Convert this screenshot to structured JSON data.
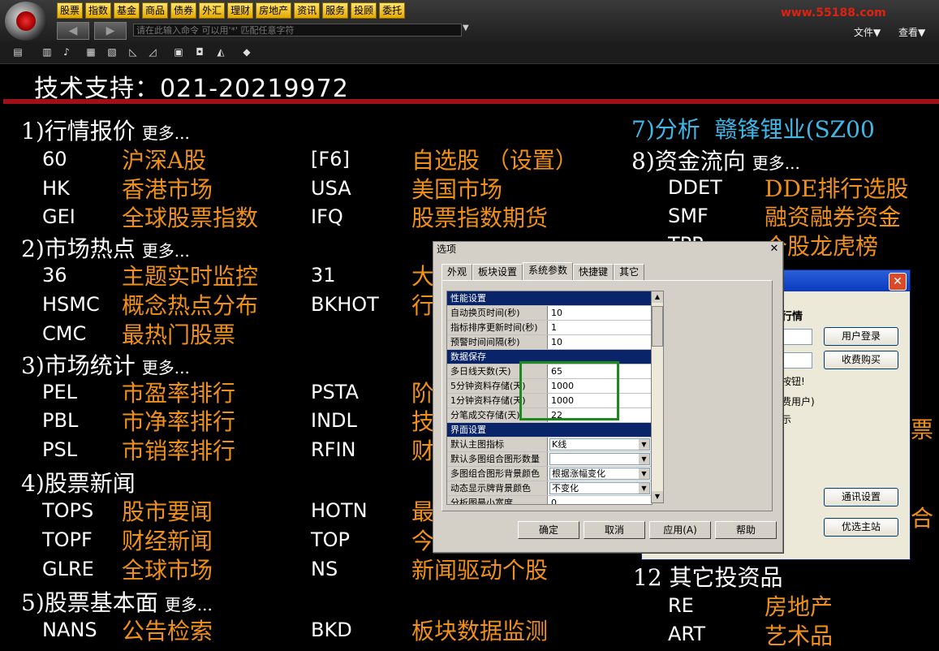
{
  "menu": [
    "股票",
    "指数",
    "基金",
    "商品",
    "债券",
    "外汇",
    "理财",
    "房地产",
    "资讯",
    "服务",
    "投顾",
    "委托"
  ],
  "command_placeholder": "请在此输入命令     可以用'*' 匹配任意字符",
  "right_menu": {
    "file": "文件▼",
    "view": "查看▼"
  },
  "site_text": "www.55188.com",
  "support": "技术支持：021-20219972",
  "sections": {
    "s1": {
      "title": "1)行情报价",
      "more": "更多..."
    },
    "s2": {
      "title": "2)市场热点",
      "more": "更多..."
    },
    "s3": {
      "title": "3)市场统计",
      "more": "更多..."
    },
    "s4": {
      "title": "4)股票新闻"
    },
    "s5": {
      "title": "5)股票基本面",
      "more": "更多..."
    },
    "s7": {
      "title": "7)分析",
      "stock": "赣锋锂业(SZ00"
    },
    "s8": {
      "title": "8)资金流向",
      "more": "更多..."
    },
    "s12": {
      "title": "12 其它投资品"
    }
  },
  "rows": {
    "r60": {
      "code": "60",
      "label": "沪深A股"
    },
    "rF6": {
      "code": "[F6]",
      "label": "自选股  （设置）"
    },
    "rHK": {
      "code": "HK",
      "label": "香港市场"
    },
    "rUSA": {
      "code": "USA",
      "label": "美国市场"
    },
    "rGEI": {
      "code": "GEI",
      "label": "全球股票指数"
    },
    "rIFQ": {
      "code": "IFQ",
      "label": "股票指数期货"
    },
    "r36": {
      "code": "36",
      "label": "主题实时监控"
    },
    "r31": {
      "code": "31",
      "label": "大"
    },
    "rHSMC": {
      "code": "HSMC",
      "label": "概念热点分布"
    },
    "rBKHOT": {
      "code": "BKHOT",
      "label": "行"
    },
    "rCMC": {
      "code": "CMC",
      "label": "最热门股票"
    },
    "rPEL": {
      "code": "PEL",
      "label": "市盈率排行"
    },
    "rPSTA": {
      "code": "PSTA",
      "label": "阶"
    },
    "rPBL": {
      "code": "PBL",
      "label": "市净率排行"
    },
    "rINDL": {
      "code": "INDL",
      "label": "技"
    },
    "rPSL": {
      "code": "PSL",
      "label": "市销率排行"
    },
    "rRFIN": {
      "code": "RFIN",
      "label": "财"
    },
    "rTOPS": {
      "code": "TOPS",
      "label": "股市要闻"
    },
    "rHOTN": {
      "code": "HOTN",
      "label": "最"
    },
    "rTOPF": {
      "code": "TOPF",
      "label": "财经新闻"
    },
    "rTOP": {
      "code": "TOP",
      "label": "今"
    },
    "rGLRE": {
      "code": "GLRE",
      "label": "全球市场"
    },
    "rNS": {
      "code": "NS",
      "label": "新闻驱动个股"
    },
    "rNANS": {
      "code": "NANS",
      "label": "公告检索"
    },
    "rBKD": {
      "code": "BKD",
      "label": "板块数据监测"
    },
    "rDDET": {
      "code": "DDET",
      "label": "DDE排行选股"
    },
    "rSMF": {
      "code": "SMF",
      "label": "融资融券资金"
    },
    "rTPP": {
      "code": "TPP",
      "label": "个股龙虎榜"
    },
    "rRE": {
      "code": "RE",
      "label": "房地产"
    },
    "rART": {
      "code": "ART",
      "label": "艺术品"
    },
    "partial1": {
      "label": "票"
    },
    "partial2": {
      "label": "合"
    }
  },
  "login_dialog": {
    "heading": "行情",
    "login_btn": "用户登录",
    "buy_btn": "收费购买",
    "note1": "按钮!",
    "note2": "费用户)",
    "note3": "示",
    "comm_btn": "通讯设置",
    "station_btn": "优选主站"
  },
  "options_dialog": {
    "title": "选项",
    "tabs": [
      "外观",
      "板块设置",
      "系统参数",
      "快捷键",
      "其它"
    ],
    "active_tab": 2,
    "groups": {
      "g1": "性能设置",
      "g2": "数据保存",
      "g3": "界面设置"
    },
    "params": [
      {
        "name": "自动换页时间(秒)",
        "value": "10"
      },
      {
        "name": "指标排序更新时间(秒)",
        "value": "1"
      },
      {
        "name": "预警时间间隔(秒)",
        "value": "10"
      },
      {
        "name": "多日线天数(天)",
        "value": "65"
      },
      {
        "name": "5分钟资料存储(天)",
        "value": "1000"
      },
      {
        "name": "1分钟资料存储(天)",
        "value": "1000"
      },
      {
        "name": "分笔成交存储(天)",
        "value": "22"
      },
      {
        "name": "默认主图指标",
        "value": "K线"
      },
      {
        "name": "默认多图组合图形数量",
        "value": ""
      },
      {
        "name": "多图组合图形背景颜色",
        "value": "根据涨幅变化"
      },
      {
        "name": "动态显示牌背景颜色",
        "value": "不变化"
      },
      {
        "name": "分析图最小宽度",
        "value": "0"
      }
    ],
    "buttons": {
      "ok": "确定",
      "cancel": "取消",
      "apply": "应用(A)",
      "help": "帮助"
    }
  }
}
